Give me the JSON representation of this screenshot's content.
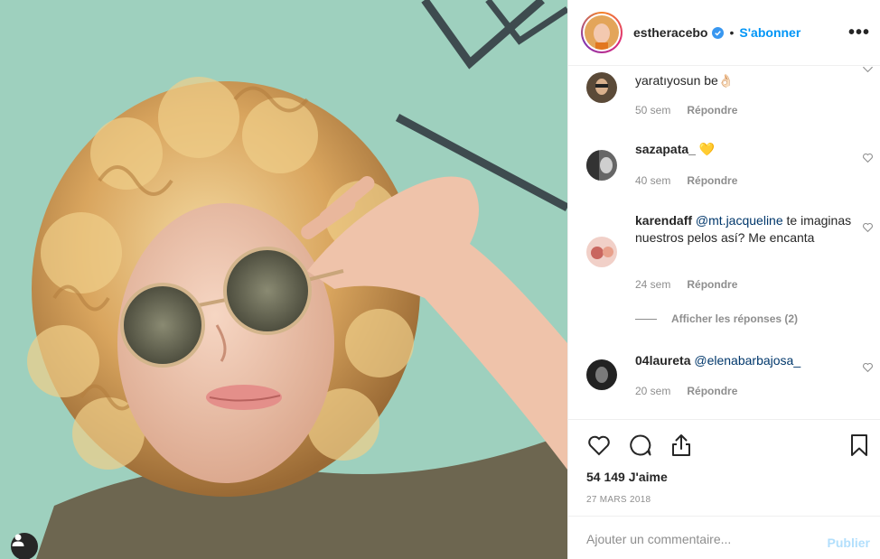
{
  "post": {
    "author": "estheracebo",
    "separator": "•",
    "follow_label": "S'abonner",
    "more_label": "•••",
    "likes_text": "54 149 J'aime",
    "date": "27 MARS 2018"
  },
  "comments": [
    {
      "user": "",
      "text": "yaratıyosun be👌🏻",
      "mention": "",
      "time": "50 sem",
      "reply_label": "Répondre"
    },
    {
      "user": "sazapata_",
      "text": "💛",
      "mention": "",
      "time": "40 sem",
      "reply_label": "Répondre"
    },
    {
      "user": "karendaff",
      "mention": "@mt.jacqueline",
      "text": "te imaginas nuestros pelos así? Me encanta",
      "time": "24 sem",
      "reply_label": "Répondre"
    },
    {
      "user": "04laureta",
      "mention": "@elenabarbajosa_",
      "text": "",
      "time": "20 sem",
      "reply_label": "Répondre"
    }
  ],
  "view_replies_label": "Afficher les réponses (2)",
  "comment_box": {
    "placeholder": "Ajouter un commentaire...",
    "publish_label": "Publier"
  },
  "colors": {
    "link_blue": "#0095f6",
    "publish_disabled": "#b2dffc",
    "muted_text": "#8e8e8e"
  },
  "icons": {
    "like": "heart-outline-icon",
    "comment": "comment-bubble-icon",
    "share": "share-upload-icon",
    "save": "bookmark-icon",
    "verified": "verified-badge-icon"
  }
}
